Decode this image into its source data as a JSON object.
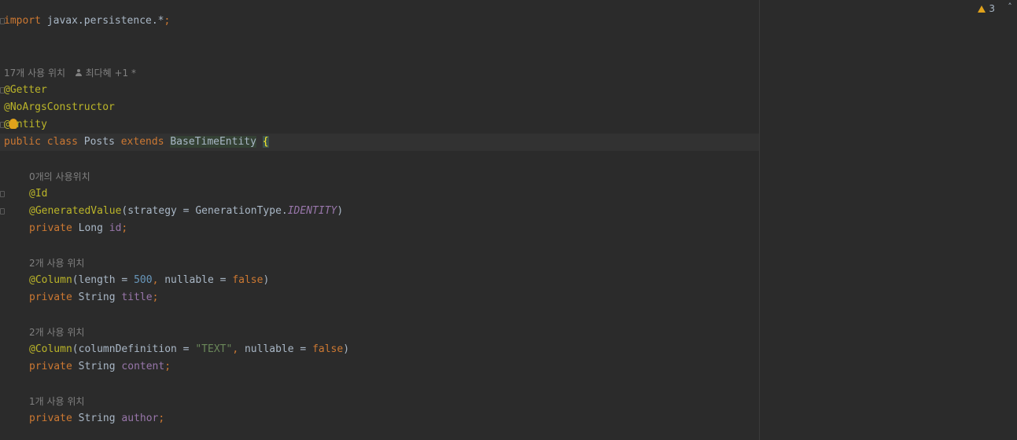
{
  "code": {
    "import_kw": "import",
    "import_path": " javax.persistence.*",
    "import_semi": ";",
    "class_hint": "17개 사용 위치",
    "class_author": "최다혜 +1 *",
    "ann_getter": "@Getter",
    "ann_noargs": "@NoArgsConstructor",
    "ann_entity_pre": "@",
    "ann_entity_post": "ntity",
    "kw_public": "public",
    "kw_class": "class",
    "class_name": "Posts",
    "kw_extends": "extends",
    "super_name": "BaseTimeEntity",
    "open_brace": "{",
    "id_hint": "0개의 사용위치",
    "ann_id": "@Id",
    "ann_generated": "@GeneratedValue",
    "gen_args_pre": "(strategy = GenerationType.",
    "gen_const": "IDENTITY",
    "gen_close": ")",
    "kw_private": "private",
    "type_long": "Long",
    "fld_id": "id",
    "semi": ";",
    "title_hint": "2개 사용 위치",
    "ann_column": "@Column",
    "col1_pre": "(length = ",
    "col1_num": "500",
    "comma": ",",
    "col1_mid": " nullable = ",
    "kw_false": "false",
    "close_paren": ")",
    "type_string": "String",
    "fld_title": "title",
    "content_hint": "2개 사용 위치",
    "col2_pre": "(columnDefinition = ",
    "col2_str": "\"TEXT\"",
    "fld_content": "content",
    "author_hint": "1개 사용 위치",
    "fld_author": "author"
  },
  "status": {
    "warning_count": "3",
    "warning_icon": "warning-triangle-icon",
    "nav_icon": "chevron-up-icon"
  },
  "colors": {
    "background": "#2b2b2b",
    "keyword": "#cc7832",
    "annotation": "#bbb529",
    "field": "#9876aa",
    "number": "#6897bb",
    "string": "#6a8759",
    "text": "#a9b7c6",
    "hint": "#808080"
  }
}
